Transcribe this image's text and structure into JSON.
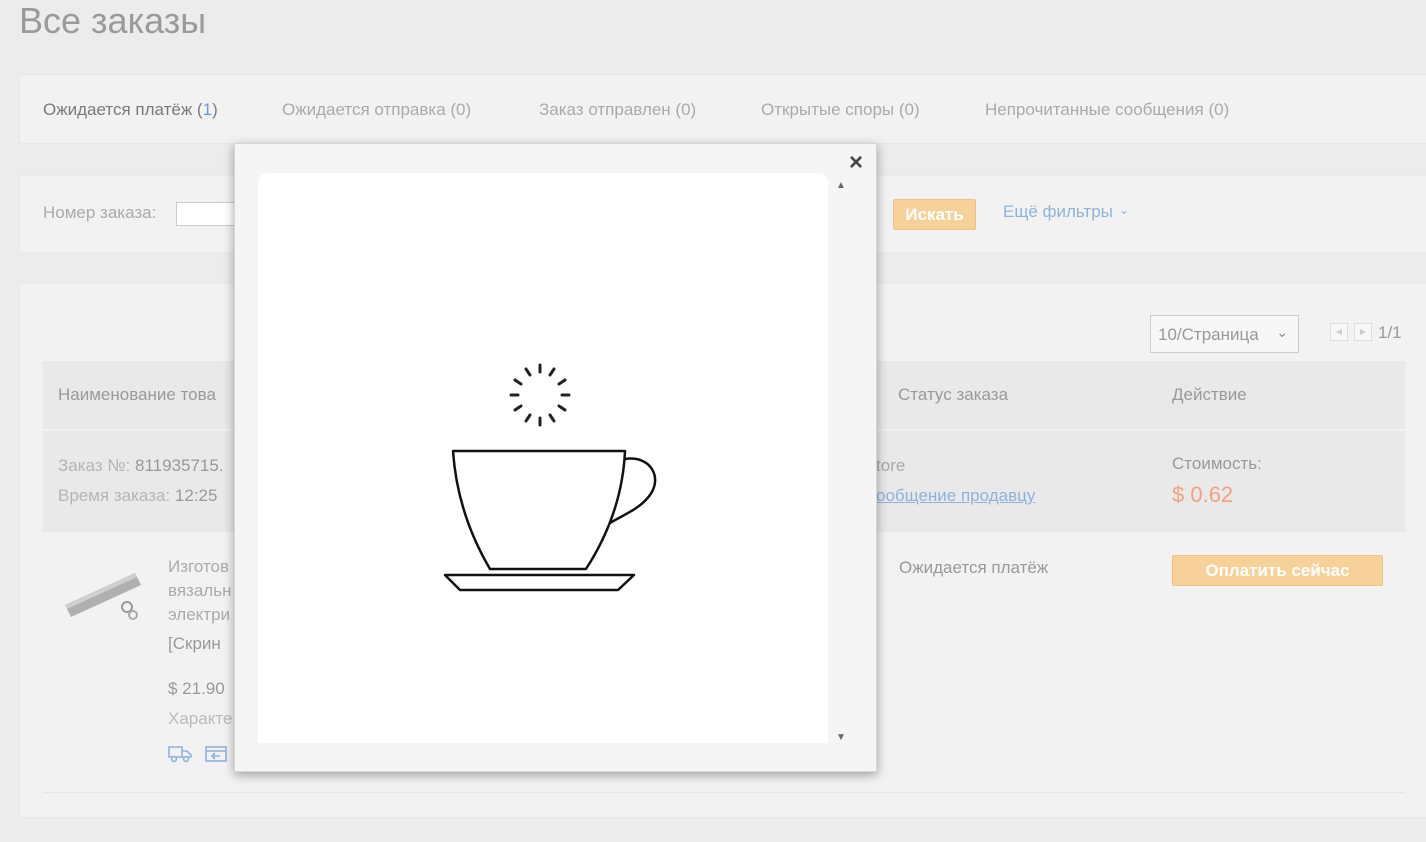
{
  "page": {
    "title": "Все заказы"
  },
  "tabs": [
    {
      "label": "Ожидается платёж (",
      "count": "1",
      "close": ")"
    },
    {
      "label": "Ожидается отправка (0)"
    },
    {
      "label": "Заказ отправлен (0)"
    },
    {
      "label": "Открытые споры (0)"
    },
    {
      "label": "Непрочитанные сообщения (0)"
    }
  ],
  "filters": {
    "order_number_label": "Номер заказа:",
    "order_number_value": "",
    "search_label": "Искать",
    "more_filters_label": "Ещё фильтры",
    "more_filters_icon": "chevron-down-icon"
  },
  "pagination": {
    "per_page": "10/Страница",
    "page_count": "1/1"
  },
  "table": {
    "headers": [
      "Наименование това",
      "Статус заказа",
      "Действие"
    ]
  },
  "order": {
    "number_label": "Заказ №:",
    "number_value": "811935715.",
    "time_label": "Время заказа:",
    "time_value": "12:25",
    "store_fragment": "tore",
    "message_link": "ообщение продавцу",
    "cost_label": "Стоимость:",
    "cost_value": "$ 0.62",
    "product_lines": [
      "Изготов",
      "вязальн",
      "электри",
      "[Скрин"
    ],
    "product_price": "$ 21.90",
    "product_char": "Характе",
    "status": "Ожидается платёж",
    "pay_label": "Оплатить сейчас",
    "icons": [
      "truck-icon",
      "return-icon"
    ]
  },
  "modal": {
    "close_label": "×",
    "content_icon": "coffee-cup-loading-icon"
  },
  "colors": {
    "accent_orange": "#f7d19a",
    "link_blue": "#8fb2dd",
    "price_orange": "#f2a181"
  }
}
